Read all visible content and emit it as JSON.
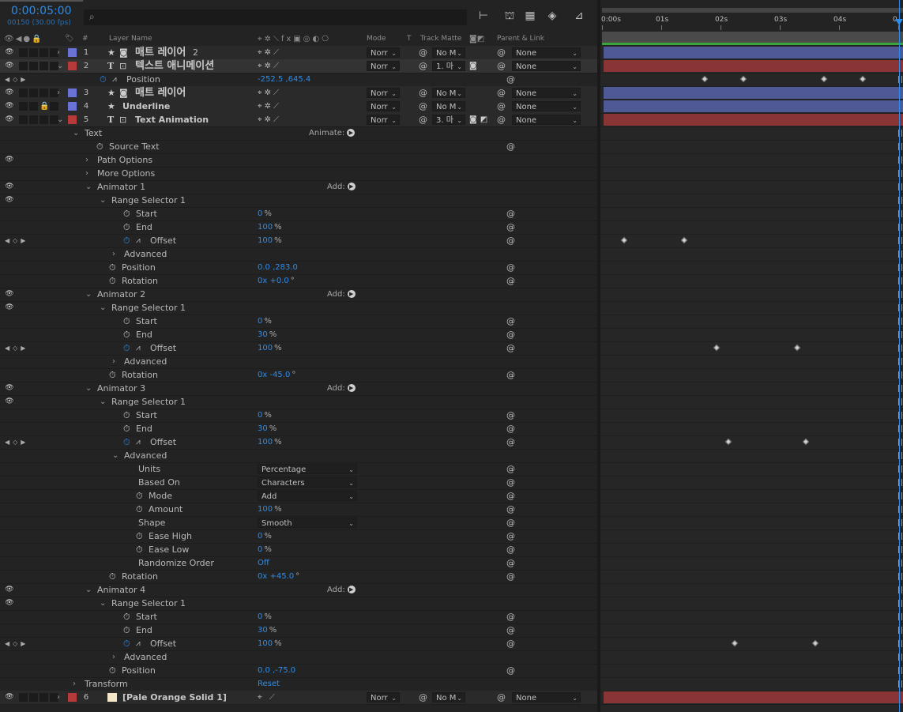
{
  "header": {
    "timecode": "0:00:05:00",
    "frame_info": "00150 (30.00 fps)",
    "search_icon": "search-icon"
  },
  "columns": {
    "layer_name": "Layer Name",
    "num": "#",
    "mode": "Mode",
    "t": "T",
    "track_matte": "Track Matte",
    "parent_link": "Parent & Link"
  },
  "ruler": {
    "ticks": [
      "0:00s",
      "01s",
      "02s",
      "03s",
      "04s",
      "0"
    ]
  },
  "colors": {
    "blue_label": "#6b72d6",
    "red_label": "#b63a3a",
    "cream_label": "#f5e6c8",
    "blue_bar": "#4f5995",
    "red_bar": "#8a3535",
    "accent": "#2d8ceb"
  },
  "rows": [
    {
      "kind": "layer",
      "num": "1",
      "type": "star",
      "name": "매트 레이어",
      "suffix": "2",
      "big": true,
      "label": "blue",
      "twirl": "›",
      "mode": "Norr",
      "matte": "No M",
      "parent": "None",
      "bar": "blue"
    },
    {
      "kind": "layer",
      "num": "2",
      "type": "T",
      "name": "텍스트 애니메이션",
      "big": true,
      "label": "red",
      "twirl": "⌄",
      "mode": "Norr",
      "matte": "1. 마",
      "parent": "None",
      "bar": "red",
      "sel": true
    },
    {
      "kind": "prop",
      "indent": 126,
      "name": "Position",
      "value": "-252.5 ,645.4",
      "stopwatch": "on",
      "graph": true,
      "nav": true,
      "pick": true,
      "kfs": [
        0.34,
        0.47,
        0.74,
        0.87
      ]
    },
    {
      "kind": "layer",
      "num": "3",
      "type": "star",
      "name": "매트 레이어",
      "big": true,
      "label": "blue",
      "twirl": "›",
      "mode": "Norr",
      "matte": "No M",
      "parent": "None",
      "bar": "blue"
    },
    {
      "kind": "layer",
      "num": "4",
      "type": "star",
      "name": "Underline",
      "label": "blue",
      "twirl": "",
      "lock": true,
      "mode": "Norr",
      "matte": "No M",
      "parent": "None",
      "bar": "blue"
    },
    {
      "kind": "layer",
      "num": "5",
      "type": "T",
      "name": "Text Animation",
      "label": "red",
      "twirl": "⌄",
      "mode": "Norr",
      "matte": "3. 마",
      "parent": "None",
      "bar": "red"
    },
    {
      "kind": "group",
      "indent": 92,
      "twirl": "⌄",
      "name": "Text",
      "add": "Animate:"
    },
    {
      "kind": "prop",
      "indent": 122,
      "name": "Source Text",
      "stopwatch": "off",
      "pick": true
    },
    {
      "kind": "group",
      "indent": 108,
      "twirl": "›",
      "name": "Path Options",
      "eye": true
    },
    {
      "kind": "group",
      "indent": 108,
      "twirl": "›",
      "name": "More Options"
    },
    {
      "kind": "group",
      "indent": 108,
      "twirl": "⌄",
      "name": "Animator 1",
      "eye": true,
      "add": "Add:"
    },
    {
      "kind": "group",
      "indent": 126,
      "twirl": "⌄",
      "name": "Range Selector 1",
      "eye": true
    },
    {
      "kind": "prop",
      "indent": 156,
      "name": "Start",
      "value": "0",
      "unit": "%",
      "stopwatch": "off",
      "pick": true
    },
    {
      "kind": "prop",
      "indent": 156,
      "name": "End",
      "value": "100",
      "unit": "%",
      "stopwatch": "off",
      "pick": true
    },
    {
      "kind": "prop",
      "indent": 156,
      "name": "Offset",
      "value": "100",
      "unit": "%",
      "stopwatch": "on",
      "graph": true,
      "nav": true,
      "pick": true,
      "kfs": [
        0.07,
        0.27
      ]
    },
    {
      "kind": "group",
      "indent": 142,
      "twirl": "›",
      "name": "Advanced"
    },
    {
      "kind": "prop",
      "indent": 138,
      "name": "Position",
      "value": "0.0 ,283.0",
      "stopwatch": "off",
      "pick": true
    },
    {
      "kind": "prop",
      "indent": 138,
      "name": "Rotation",
      "value": "0x +0.0",
      "unit": "°",
      "stopwatch": "off",
      "pick": true
    },
    {
      "kind": "group",
      "indent": 108,
      "twirl": "⌄",
      "name": "Animator 2",
      "eye": true,
      "add": "Add:"
    },
    {
      "kind": "group",
      "indent": 126,
      "twirl": "⌄",
      "name": "Range Selector 1",
      "eye": true
    },
    {
      "kind": "prop",
      "indent": 156,
      "name": "Start",
      "value": "0",
      "unit": "%",
      "stopwatch": "off",
      "pick": true
    },
    {
      "kind": "prop",
      "indent": 156,
      "name": "End",
      "value": "30",
      "unit": "%",
      "stopwatch": "off",
      "pick": true
    },
    {
      "kind": "prop",
      "indent": 156,
      "name": "Offset",
      "value": "100",
      "unit": "%",
      "stopwatch": "on",
      "graph": true,
      "nav": true,
      "pick": true,
      "kfs": [
        0.38,
        0.65
      ]
    },
    {
      "kind": "group",
      "indent": 142,
      "twirl": "›",
      "name": "Advanced"
    },
    {
      "kind": "prop",
      "indent": 138,
      "name": "Rotation",
      "value": "0x -45.0",
      "unit": "°",
      "stopwatch": "off",
      "pick": true
    },
    {
      "kind": "group",
      "indent": 108,
      "twirl": "⌄",
      "name": "Animator 3",
      "eye": true,
      "add": "Add:"
    },
    {
      "kind": "group",
      "indent": 126,
      "twirl": "⌄",
      "name": "Range Selector 1",
      "eye": true
    },
    {
      "kind": "prop",
      "indent": 156,
      "name": "Start",
      "value": "0",
      "unit": "%",
      "stopwatch": "off",
      "pick": true
    },
    {
      "kind": "prop",
      "indent": 156,
      "name": "End",
      "value": "30",
      "unit": "%",
      "stopwatch": "off",
      "pick": true
    },
    {
      "kind": "prop",
      "indent": 156,
      "name": "Offset",
      "value": "100",
      "unit": "%",
      "stopwatch": "on",
      "graph": true,
      "nav": true,
      "pick": true,
      "kfs": [
        0.42,
        0.68
      ]
    },
    {
      "kind": "group",
      "indent": 142,
      "twirl": "⌄",
      "name": "Advanced"
    },
    {
      "kind": "prop",
      "indent": 160,
      "name": "Units",
      "dropdown": "Percentage",
      "nostop": true,
      "pick": true
    },
    {
      "kind": "prop",
      "indent": 160,
      "name": "Based On",
      "dropdown": "Characters",
      "nostop": true,
      "pick": true
    },
    {
      "kind": "prop",
      "indent": 172,
      "name": "Mode",
      "dropdown": "Add",
      "stopwatch": "off",
      "pick": true
    },
    {
      "kind": "prop",
      "indent": 172,
      "name": "Amount",
      "value": "100",
      "unit": "%",
      "stopwatch": "off",
      "pick": true
    },
    {
      "kind": "prop",
      "indent": 160,
      "name": "Shape",
      "dropdown": "Smooth",
      "nostop": true,
      "pick": true
    },
    {
      "kind": "prop",
      "indent": 172,
      "name": "Ease High",
      "value": "0",
      "unit": "%",
      "stopwatch": "off",
      "pick": true
    },
    {
      "kind": "prop",
      "indent": 172,
      "name": "Ease Low",
      "value": "0",
      "unit": "%",
      "stopwatch": "off",
      "pick": true
    },
    {
      "kind": "prop",
      "indent": 160,
      "name": "Randomize Order",
      "value": "Off",
      "nostop": true,
      "pick": true
    },
    {
      "kind": "prop",
      "indent": 138,
      "name": "Rotation",
      "value": "0x +45.0",
      "unit": "°",
      "stopwatch": "off",
      "pick": true
    },
    {
      "kind": "group",
      "indent": 108,
      "twirl": "⌄",
      "name": "Animator 4",
      "eye": true,
      "add": "Add:"
    },
    {
      "kind": "group",
      "indent": 126,
      "twirl": "⌄",
      "name": "Range Selector 1",
      "eye": true
    },
    {
      "kind": "prop",
      "indent": 156,
      "name": "Start",
      "value": "0",
      "unit": "%",
      "stopwatch": "off",
      "pick": true
    },
    {
      "kind": "prop",
      "indent": 156,
      "name": "End",
      "value": "30",
      "unit": "%",
      "stopwatch": "off",
      "pick": true
    },
    {
      "kind": "prop",
      "indent": 156,
      "name": "Offset",
      "value": "100",
      "unit": "%",
      "stopwatch": "on",
      "graph": true,
      "nav": true,
      "pick": true,
      "kfs": [
        0.44,
        0.71
      ]
    },
    {
      "kind": "group",
      "indent": 142,
      "twirl": "›",
      "name": "Advanced"
    },
    {
      "kind": "prop",
      "indent": 138,
      "name": "Position",
      "value": "0.0 ,-75.0",
      "stopwatch": "off",
      "pick": true
    },
    {
      "kind": "group",
      "indent": 92,
      "twirl": "›",
      "name": "Transform",
      "reset": "Reset"
    },
    {
      "kind": "layer",
      "num": "6",
      "type": "solid",
      "name": "[Pale Orange Solid 1]",
      "label": "red",
      "twirl": "›",
      "mode": "Norr",
      "matte": "No M",
      "parent": "None",
      "bar": "red",
      "solid": true
    }
  ]
}
